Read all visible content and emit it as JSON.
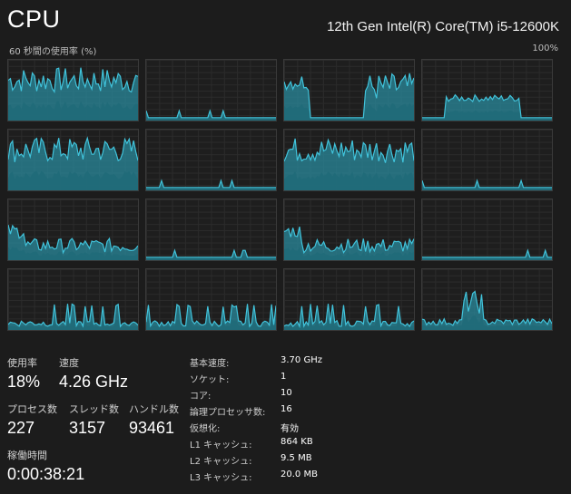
{
  "header": {
    "title": "CPU",
    "cpu_name": "12th Gen Intel(R) Core(TM) i5-12600K",
    "graph_label": "60 秒間の使用率 (%)",
    "graph_max": "100%"
  },
  "colors": {
    "line": "#41c4dc",
    "fill": "#2a8a9c",
    "fill_dim": "#1f6a78",
    "background": "#1c1c1c"
  },
  "stats": {
    "usage_label": "使用率",
    "usage_value": "18%",
    "speed_label": "速度",
    "speed_value": "4.26 GHz",
    "processes_label": "プロセス数",
    "processes_value": "227",
    "threads_label": "スレッド数",
    "threads_value": "3157",
    "handles_label": "ハンドル数",
    "handles_value": "93461",
    "uptime_label": "稼働時間",
    "uptime_value": "0:00:38:21"
  },
  "specs": [
    {
      "key": "基本速度:",
      "value": "3.70 GHz"
    },
    {
      "key": "ソケット:",
      "value": "1"
    },
    {
      "key": "コア:",
      "value": "10"
    },
    {
      "key": "論理プロセッサ数:",
      "value": "16"
    },
    {
      "key": "仮想化:",
      "value": "有効"
    },
    {
      "key": "L1 キャッシュ:",
      "value": "864 KB"
    },
    {
      "key": "L2 キャッシュ:",
      "value": "9.5 MB"
    },
    {
      "key": "L3 キャッシュ:",
      "value": "20.0 MB"
    }
  ],
  "cores": [
    {
      "profile": "high"
    },
    {
      "profile": "idle"
    },
    {
      "profile": "burst"
    },
    {
      "profile": "plateau"
    },
    {
      "profile": "high"
    },
    {
      "profile": "idle"
    },
    {
      "profile": "high"
    },
    {
      "profile": "idle"
    },
    {
      "profile": "medium"
    },
    {
      "profile": "idle"
    },
    {
      "profile": "medium"
    },
    {
      "profile": "idle"
    },
    {
      "profile": "low"
    },
    {
      "profile": "low"
    },
    {
      "profile": "low"
    },
    {
      "profile": "spike"
    }
  ]
}
